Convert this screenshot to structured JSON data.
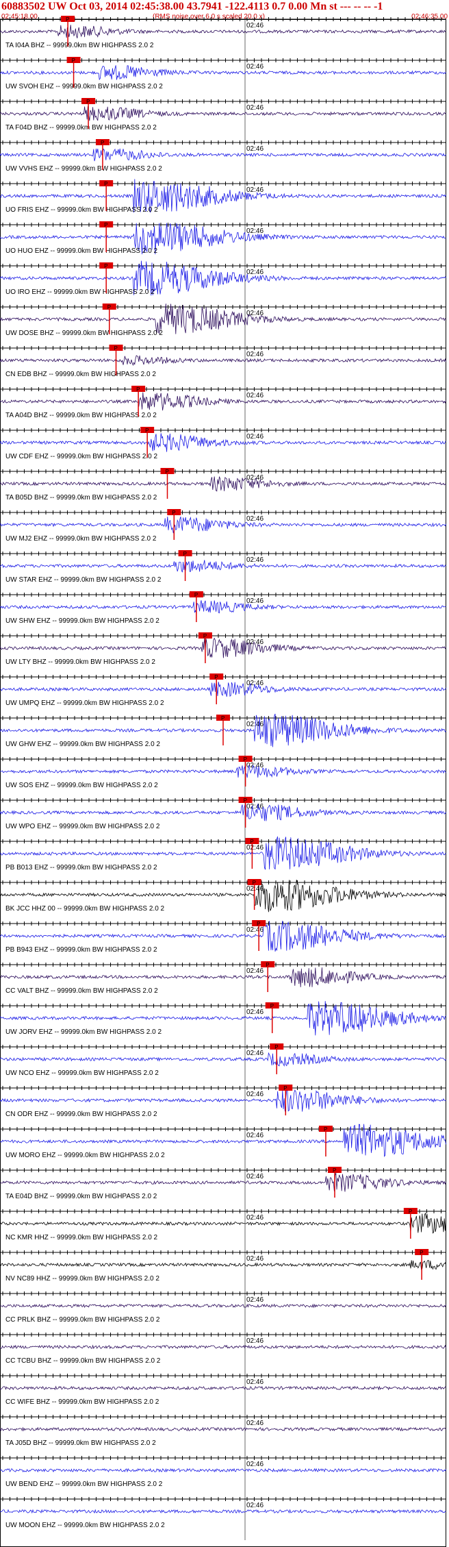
{
  "header": {
    "title": "60883502 UW Oct 03, 2014 02:45:38.00   43.7941 -122.4113  0.7 0.00 Mn st --- -- -- -1",
    "subtitle": "(RMS noise over 6.0 s scaled 20.0 x)",
    "time_start": "02:45:18.00",
    "time_end": "02:46:35.00"
  },
  "chart_data": {
    "type": "line",
    "minute_label": "02:46",
    "filter_text": "-- 99999.0km BW  HIGHPASS  2.0  2",
    "pick_label": "P",
    "colors": {
      "blue": "#1a1ae6",
      "dark": "#2a0a5a",
      "black": "#000000",
      "pick": "#dd0000",
      "axis": "#000000"
    },
    "traces": [
      {
        "station": "TA I04A BHZ",
        "color": "dark",
        "pick_rel": 0.152,
        "burst_rel": 0.16,
        "amp": 0.3
      },
      {
        "station": "UW SVOH EHZ",
        "color": "blue",
        "pick_rel": 0.165,
        "burst_rel": 0.25,
        "amp": 0.35
      },
      {
        "station": "TA F04D BHZ",
        "color": "dark",
        "pick_rel": 0.198,
        "burst_rel": 0.22,
        "amp": 0.35
      },
      {
        "station": "UW VVHS EHZ",
        "color": "blue",
        "pick_rel": 0.23,
        "burst_rel": 0.24,
        "amp": 0.3
      },
      {
        "station": "UO FRIS EHZ",
        "color": "blue",
        "pick_rel": 0.238,
        "burst_rel": 0.33,
        "amp": 0.9
      },
      {
        "station": "UO HUO EHZ",
        "color": "blue",
        "pick_rel": 0.238,
        "burst_rel": 0.33,
        "amp": 0.9
      },
      {
        "station": "UO IRO EHZ",
        "color": "blue",
        "pick_rel": 0.238,
        "burst_rel": 0.33,
        "amp": 0.9
      },
      {
        "station": "UW DOSE BHZ",
        "color": "dark",
        "pick_rel": 0.245,
        "burst_rel": 0.38,
        "amp": 0.8
      },
      {
        "station": "CN EDB BHZ",
        "color": "dark",
        "pick_rel": 0.26,
        "burst_rel": 0.3,
        "amp": 0.2
      },
      {
        "station": "TA A04D BHZ",
        "color": "dark",
        "pick_rel": 0.31,
        "burst_rel": 0.34,
        "amp": 0.45
      },
      {
        "station": "UW CDF EHZ",
        "color": "blue",
        "pick_rel": 0.33,
        "burst_rel": 0.36,
        "amp": 0.45
      },
      {
        "station": "TA B05D BHZ",
        "color": "dark",
        "pick_rel": 0.375,
        "burst_rel": 0.5,
        "amp": 0.35
      },
      {
        "station": "UW MJ2 EHZ",
        "color": "blue",
        "pick_rel": 0.39,
        "burst_rel": 0.4,
        "amp": 0.4
      },
      {
        "station": "UW STAR EHZ",
        "color": "blue",
        "pick_rel": 0.415,
        "burst_rel": 0.42,
        "amp": 0.3
      },
      {
        "station": "UW SHW EHZ",
        "color": "blue",
        "pick_rel": 0.44,
        "burst_rel": 0.46,
        "amp": 0.3
      },
      {
        "station": "UW LTY BHZ",
        "color": "dark",
        "pick_rel": 0.46,
        "burst_rel": 0.48,
        "amp": 0.5
      },
      {
        "station": "UW UMPQ EHZ",
        "color": "blue",
        "pick_rel": 0.485,
        "burst_rel": 0.5,
        "amp": 0.35
      },
      {
        "station": "UW GHW EHZ",
        "color": "blue",
        "pick_rel": 0.5,
        "burst_rel": 0.6,
        "amp": 0.9
      },
      {
        "station": "UW SOS EHZ",
        "color": "blue",
        "pick_rel": 0.55,
        "burst_rel": 0.56,
        "amp": 0.3
      },
      {
        "station": "UW WPO EHZ",
        "color": "blue",
        "pick_rel": 0.55,
        "burst_rel": 0.57,
        "amp": 0.45
      },
      {
        "station": "PB B013 EHZ",
        "color": "blue",
        "pick_rel": 0.565,
        "burst_rel": 0.62,
        "amp": 0.9
      },
      {
        "station": "BK JCC HHZ 00",
        "color": "black",
        "pick_rel": 0.57,
        "burst_rel": 0.6,
        "amp": 0.9
      },
      {
        "station": "PB B943 EHZ",
        "color": "blue",
        "pick_rel": 0.58,
        "burst_rel": 0.62,
        "amp": 0.8
      },
      {
        "station": "CC VALT BHZ",
        "color": "dark",
        "pick_rel": 0.6,
        "burst_rel": 0.68,
        "amp": 0.5
      },
      {
        "station": "UW JORV EHZ",
        "color": "blue",
        "pick_rel": 0.61,
        "burst_rel": 0.72,
        "amp": 0.9
      },
      {
        "station": "UW NCO EHZ",
        "color": "blue",
        "pick_rel": 0.62,
        "burst_rel": 0.63,
        "amp": 0.3
      },
      {
        "station": "CN ODR EHZ",
        "color": "blue",
        "pick_rel": 0.64,
        "burst_rel": 0.65,
        "amp": 0.6
      },
      {
        "station": "UW MORO EHZ",
        "color": "blue",
        "pick_rel": 0.73,
        "burst_rel": 0.8,
        "amp": 0.9
      },
      {
        "station": "TA E04D BHZ",
        "color": "dark",
        "pick_rel": 0.75,
        "burst_rel": 0.76,
        "amp": 0.45
      },
      {
        "station": "NC KMR HHZ",
        "color": "black",
        "pick_rel": 0.92,
        "burst_rel": 0.95,
        "amp": 0.5
      },
      {
        "station": "NV NC89 HHZ",
        "color": "black",
        "pick_rel": 0.945,
        "burst_rel": 0.95,
        "amp": 0.2
      },
      {
        "station": "CC PRLK BHZ",
        "color": "dark",
        "pick_rel": null,
        "burst_rel": null,
        "amp": 0.15
      },
      {
        "station": "CC TCBU BHZ",
        "color": "dark",
        "pick_rel": null,
        "burst_rel": null,
        "amp": 0.15
      },
      {
        "station": "CC WIFE BHZ",
        "color": "dark",
        "pick_rel": null,
        "burst_rel": null,
        "amp": 0.15
      },
      {
        "station": "TA J05D BHZ",
        "color": "dark",
        "pick_rel": null,
        "burst_rel": null,
        "amp": 0.15
      },
      {
        "station": "UW BEND EHZ",
        "color": "blue",
        "pick_rel": null,
        "burst_rel": null,
        "amp": 0.15
      },
      {
        "station": "UW MOON EHZ",
        "color": "blue",
        "pick_rel": null,
        "burst_rel": null,
        "amp": 0.15
      }
    ]
  }
}
